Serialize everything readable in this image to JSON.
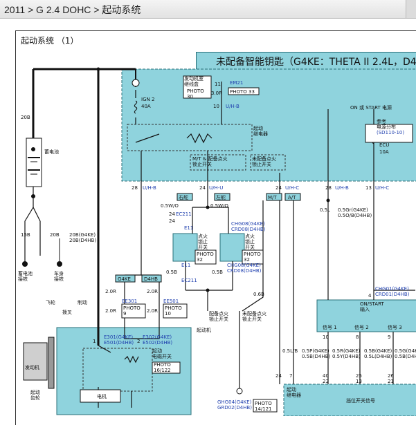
{
  "breadcrumb": "2011 > G 2.4 DOHC > 起动系统",
  "title": "起动系统 （1）",
  "banner": "未配备智能钥匙（G4KE：THETA II 2.4L，D4HB",
  "colors": {
    "panel": "#8fd3dd",
    "panel_border": "#2a6f78",
    "label_blue": "#1f3fae",
    "wire": "#111111"
  },
  "labels": {
    "engine_fuse_box": "发动机室\n继线盒",
    "photo30": "PHOTO\n30",
    "em21": "EM21",
    "photo33": "PHOTO 33",
    "pin11": "11",
    "wire_30r": "3.0R",
    "pin10": "10",
    "u_hb_top": "U/H-B",
    "ign2": "IGN 2",
    "ign2_amp": "40A",
    "on_start": "ON 或 START 电源",
    "ref_power": "参考\n电源分布",
    "sd110": "(SD110-10)",
    "ecu": "ECU",
    "ecu_amp": "10A",
    "start_relay": "起动\n继电器",
    "mt_note": "M/T & 配备点火\n锁止开关",
    "no_lock_note": "未配备点火\n锁止开关",
    "battery": "蓄电池",
    "w20b": "20B",
    "w15b": "15B",
    "w20b2": "20B",
    "w20b_g": "20B(G4KE)",
    "w20b_d": "20B(D4HB)",
    "batt_ground": "蓄电池\n接铁",
    "body_ground": "车身\n接铁",
    "p28": "28",
    "uhb1": "U/H-B",
    "p24a": "24",
    "uhu": "U/H-U",
    "p24b": "24",
    "uhc": "U/H-C",
    "p28b": "28",
    "uhb2": "U/H-B",
    "p13": "13",
    "uhc2": "U/H-C",
    "rhd": "右舵",
    "lhd": "左舵",
    "wo1": "0.5W/O",
    "wo2": "0.5W/O",
    "ec211": "EC211",
    "p24c": "24",
    "p24d": "24",
    "e11": "E11",
    "chg08": "CHG08(G4KE)",
    "grd08": "CRD08(D4HB)",
    "lock_sw1": "点火\n锁止\n开关",
    "lock_sw2": "点火\n锁止\n开关",
    "photo32a": "PHOTO\n32",
    "photo32b": "PHOTO\n32",
    "e11b": "E11",
    "chg08b": "CHG08(G4KE)",
    "grd08b": "CRD08(D4HB)",
    "w05b1": "0.5B",
    "w05b2": "0.5B",
    "ec211b": "EC211",
    "mt": "M/T",
    "at": "A/T",
    "w05l": "0.5L",
    "w05gr": "0.5Gr(G4KE)",
    "w05ob": "0.5O/B(D4HB)",
    "g4ke": "G4KE",
    "d4hb": "D4HB",
    "w20r1": "2.0R",
    "w20r2": "2.0R",
    "w20r3": "2.0R",
    "w20r4": "2.0R",
    "ee301": "EE301",
    "ee501": "EE501",
    "photo9": "PHOTO\n9",
    "photo10": "PHOTO\n10",
    "starter": "起动机",
    "e301": "E301(G4KE)",
    "e501": "E501(D4HB)",
    "e302": "E302(G4KE)",
    "e502": "E502(D4HB)",
    "starter_sw": "起动\n电磁开关",
    "photo16": "PHOTO\n16/122",
    "flywheel": "飞轮",
    "brake": "制动",
    "fork": "拨叉",
    "engine": "发动机",
    "starter_gear": "起动\n齿轮",
    "motor": "电机",
    "with_lock": "配备点火\n锁止开关",
    "no_lock": "未配备点火\n锁止开关",
    "w06b": "0.6B",
    "ghg04": "GHG04(G4KE)",
    "grd02": "GRD02(D4HB)",
    "photo14": "PHOTO\n14/121",
    "chg01": "CHG01(G4KE)",
    "grd01": "CRD01(D4HB)",
    "on_start2": "ON/START\n输入",
    "sig1": "信号 1",
    "sig2": "信号 2",
    "sig3": "信号 3",
    "w05lb": "0.5L/B",
    "w05p": "0.5P(G4KE)",
    "w05b_d": "0.5B(D4HB)",
    "w05r": "0.5R(G4KE)",
    "w05y": "0.5Y(D4HB)",
    "w05bg": "0.5B(G4KE)",
    "w05l_d": "0.5L(D4HB)",
    "w05g": "0.5G(G4KE)",
    "w05bd": "0.5B(D4HB)",
    "start_relay2": "起动\n继电器",
    "range_sw": "挡位开关信号",
    "p24e": "24",
    "p7": "7",
    "p40": "40",
    "p23": "23",
    "p25": "25",
    "p13b": "13",
    "p26": "26",
    "p21": "21",
    "p10": "10",
    "p8": "8",
    "p9": "9",
    "p4": "4",
    "p1": "1",
    "p2": "2"
  }
}
